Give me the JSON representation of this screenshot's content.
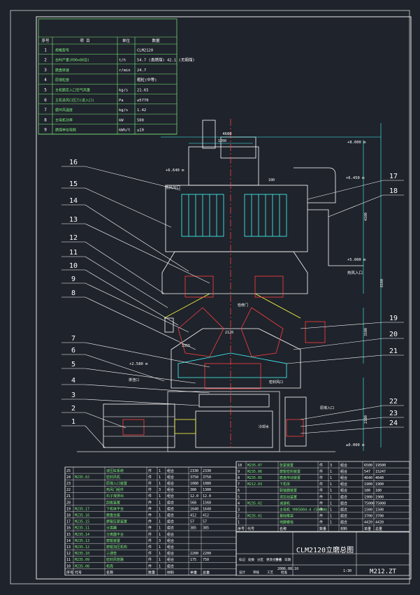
{
  "spec_table": {
    "header": [
      "序号",
      "项 目",
      "单位",
      "数据"
    ],
    "rows": [
      [
        "1",
        "规格型号",
        "",
        "CLM2120"
      ],
      [
        "2",
        "台时产量(R90=80目)",
        "t/h",
        "54.7 (直燃煤) 42.1 (无烟煤)"
      ],
      [
        "3",
        "磨盘转速",
        "r/min",
        "24.7"
      ],
      [
        "4",
        "原煤粒度",
        "",
        "粗粒(中等)"
      ],
      [
        "5",
        "主机额定入口空气风量",
        "kg/s",
        "21.65"
      ],
      [
        "6",
        "主机进风口压力(进入口)",
        "Pa",
        "≤5770"
      ],
      [
        "7",
        "循环风温度",
        "kg/s",
        "1.42"
      ],
      [
        "8",
        "主电机功率",
        "kW",
        "500"
      ],
      [
        "9",
        "磨煤单位电耗",
        "kWh/t",
        "≤10"
      ]
    ]
  },
  "part_numbers": [
    "16",
    "15",
    "14",
    "13",
    "12",
    "11",
    "10",
    "9",
    "8",
    "7",
    "6",
    "5",
    "4",
    "3",
    "2",
    "1",
    "17",
    "18",
    "19",
    "20",
    "21",
    "22",
    "23",
    "24"
  ],
  "dimensions": {
    "top_width": "4680",
    "upper_width": "1260",
    "elev_top": "+8.000 m",
    "elev_pipe": "+6.450 m",
    "elev_left": "+6.640 m",
    "elev_duct": "+5.000 m",
    "elev_mid": "+2.580 m",
    "elev_base": "±0.000 m",
    "small_1": "100",
    "small_2": "2120",
    "small_3": "3355",
    "vert_1": "4100",
    "vert_2": "8160",
    "vert_3": "3100",
    "vert_4": "2100"
  },
  "labels": {
    "air_outlet": "热风出口",
    "air_inlet": "热风入口",
    "upper_gate": "检修门",
    "side_gate": "排渣口",
    "seal_air": "密封风口",
    "raw_feed": "原煤入口",
    "water_in": "冷却水"
  },
  "parts_left": {
    "rows": [
      [
        "25",
        "",
        "液压缸系统",
        "件",
        "1",
        "组合",
        "2330",
        "2330"
      ],
      [
        "24",
        "M235.0J",
        "密封风机",
        "件",
        "1",
        "组合",
        "3750",
        "3750"
      ],
      [
        "23",
        "",
        "原煤入口装置",
        "件",
        "1",
        "组合",
        "1080",
        "1080"
      ],
      [
        "22",
        "",
        "热风门组件",
        "件",
        "3",
        "组合",
        "300",
        "1300"
      ],
      [
        "21",
        "",
        "石子煤排出",
        "件",
        "1",
        "组合",
        "12.0",
        "12.0"
      ],
      [
        "20",
        "",
        "刮板装置",
        "件",
        "1",
        "组合",
        "568",
        "1568"
      ],
      [
        "19",
        "M235.17",
        "下机体平台",
        "件",
        "1",
        "组合",
        "1640",
        "1640"
      ],
      [
        "18",
        "M235.16",
        "磨盘台座",
        "件",
        "1",
        "组合",
        "412",
        "412"
      ],
      [
        "17",
        "M235.15",
        "磨辊压紧装置",
        "件",
        "1",
        "组合",
        "57",
        "57"
      ],
      [
        "16",
        "M235.11",
        "分离器",
        "件",
        "1",
        "组合",
        "385",
        "385"
      ],
      [
        "15",
        "M235.14",
        "分离器平台",
        "件",
        "1",
        "组合",
        "",
        ""
      ],
      [
        "14",
        "M235.13",
        "磨辊装置",
        "件",
        "3",
        "组合",
        "",
        ""
      ],
      [
        "13",
        "M235.12",
        "磨辊加压机构",
        "件",
        "1",
        "组合",
        "",
        ""
      ],
      [
        "12",
        "M235.10",
        "三通管",
        "件",
        "1",
        "组合",
        "2200",
        "2200"
      ],
      [
        "11",
        "M235.09",
        "密封风管路",
        "件",
        "1",
        "组合",
        "175",
        "750"
      ],
      [
        "10",
        "M235.08",
        "机壳",
        "件",
        "1",
        "组合",
        "",
        ""
      ]
    ],
    "footer": [
      "序号",
      "代号",
      "名称",
      "数量",
      "材料",
      "单重",
      "总重"
    ]
  },
  "parts_right": {
    "rows": [
      [
        "10",
        "M235.07",
        "张紧装置",
        "件",
        "3",
        "组合",
        "6500",
        "19500"
      ],
      [
        "9",
        "M235.06",
        "磨辊密封装置",
        "件",
        "1",
        "组合",
        "547",
        "15247"
      ],
      [
        "8",
        "M235.05",
        "磨盘传动装置",
        "件",
        "1",
        "组合",
        "4640",
        "4640"
      ],
      [
        "7",
        "M212.03",
        "下机体",
        "件",
        "1",
        "组合",
        "1900",
        "1900"
      ],
      [
        "6",
        "",
        "联轴器装置",
        "件",
        "1",
        "组合",
        "180",
        "180"
      ],
      [
        "5",
        "",
        "液压站装置",
        "件",
        "1",
        "组合",
        "1900",
        "1900"
      ],
      [
        "4",
        "M235.02",
        "减速机",
        "件",
        "1",
        "组合",
        "75000",
        "75000"
      ],
      [
        "3",
        "",
        "主电机 YKK5004-4 (500kW)",
        "件",
        "1",
        "组合",
        "1500",
        "1500"
      ],
      [
        "2",
        "M235.01",
        "基础框架",
        "件",
        "1",
        "组合",
        "3700",
        "3700"
      ],
      [
        "1",
        "",
        "地脚螺栓",
        "件",
        "1",
        "组合",
        "4439",
        "4439"
      ]
    ],
    "footer": [
      "序号",
      "代号",
      "名称",
      "数量",
      "材料",
      "单重",
      "总重"
    ]
  },
  "title_block": {
    "title": "CLM2120立磨总图",
    "drawing_no": "M212.ZT",
    "date": "2006.08.10",
    "scale": "1:30",
    "sheet_labels": [
      "标记",
      "处数",
      "分区",
      "更改文件号",
      "签名",
      "日期"
    ],
    "roles": [
      "设计",
      "审核",
      "工艺",
      "批准"
    ]
  }
}
